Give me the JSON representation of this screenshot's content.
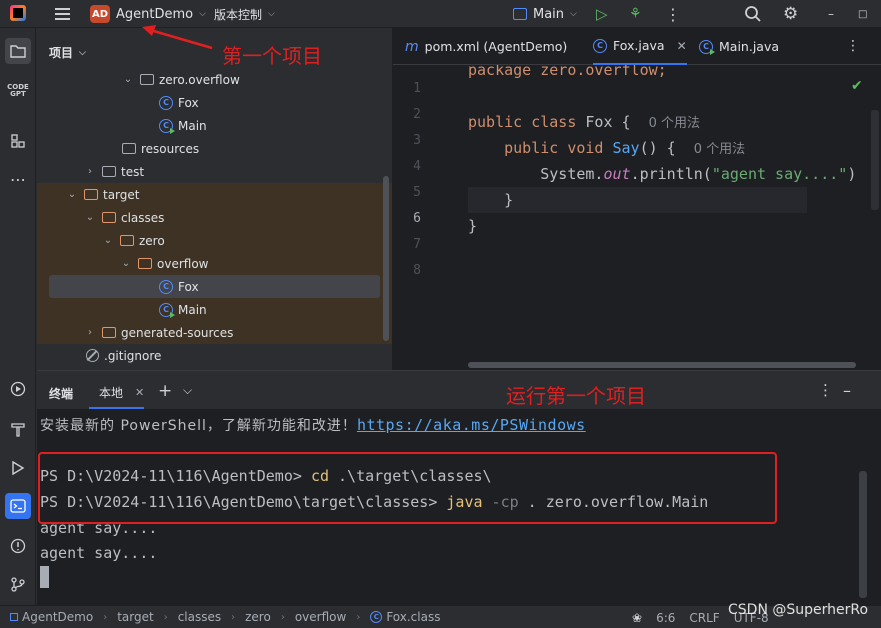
{
  "titlebar": {
    "project_badge": "AD",
    "project_name": "AgentDemo",
    "vcs_label": "版本控制",
    "run_config": "Main"
  },
  "project_panel": {
    "title": "项目",
    "tree": [
      {
        "label": "zero.overflow",
        "kind": "package"
      },
      {
        "label": "Fox",
        "kind": "class"
      },
      {
        "label": "Main",
        "kind": "main"
      },
      {
        "label": "resources",
        "kind": "folder"
      },
      {
        "label": "test",
        "kind": "folder"
      },
      {
        "label": "target",
        "kind": "folder-excluded"
      },
      {
        "label": "classes",
        "kind": "folder-excluded"
      },
      {
        "label": "zero",
        "kind": "folder-excluded"
      },
      {
        "label": "overflow",
        "kind": "folder-excluded"
      },
      {
        "label": "Fox",
        "kind": "class-selected"
      },
      {
        "label": "Main",
        "kind": "main-excluded"
      },
      {
        "label": "generated-sources",
        "kind": "folder-excluded"
      },
      {
        "label": ".gitignore",
        "kind": "ignore"
      }
    ]
  },
  "editor": {
    "tabs": [
      {
        "label": "pom.xml (AgentDemo)",
        "icon": "maven-icon"
      },
      {
        "label": "Fox.java",
        "icon": "class-icon",
        "active": true
      },
      {
        "label": "Main.java",
        "icon": "main-class-icon"
      }
    ],
    "line_numbers": [
      "1",
      "2",
      "3",
      "4",
      "5",
      "6",
      "7",
      "8"
    ],
    "current_line": "6",
    "code": {
      "line1": "package zero.overflow;",
      "line3_kw": "public class",
      "line3_name": " Fox {",
      "line3_hint": "0 个用法",
      "line4_kw": "public void",
      "line4_fn": "Say",
      "line4_rest": "() {",
      "line4_hint": "0 个用法",
      "line5_a": "System.",
      "line5_out": "out",
      "line5_b": ".println(",
      "line5_str": "\"agent say....\"",
      "line5_c": ")",
      "line6": "}",
      "line7": "}"
    }
  },
  "terminal": {
    "title": "终端",
    "tab_label": "本地",
    "tip_text": "安装最新的 PowerShell，了解新功能和改进！",
    "tip_link": "https://aka.ms/PSWindows",
    "line1_prompt": "PS D:\\V2024-11\\116\\AgentDemo> ",
    "line1_cmd": "cd",
    "line1_arg": " .\\target\\classes\\",
    "line2_prompt": "PS D:\\V2024-11\\116\\AgentDemo\\target\\classes> ",
    "line2_cmd": "java",
    "line2_flag": " -cp",
    "line2_arg": " . zero.overflow.Main",
    "output1": "agent say....",
    "output2": "agent say...."
  },
  "annotations": {
    "first_project": "第一个项目",
    "run_first_project": "运行第一个项目",
    "color": "#e02020"
  },
  "statusbar": {
    "breadcrumbs": [
      "AgentDemo",
      "target",
      "classes",
      "zero",
      "overflow",
      "Fox.class"
    ],
    "position": "6:6",
    "line_sep": "CRLF",
    "encoding": "UTF-8"
  },
  "watermark": "CSDN @SuperherRo"
}
